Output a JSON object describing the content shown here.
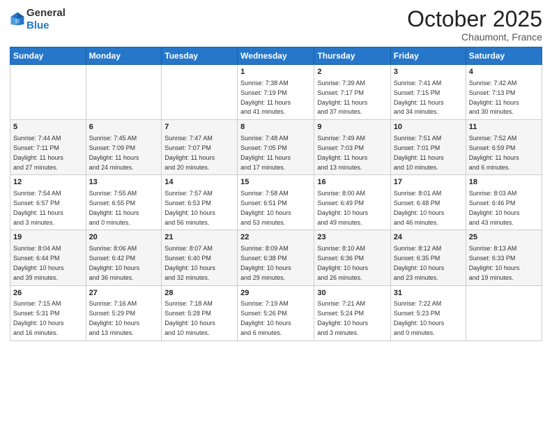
{
  "header": {
    "logo_general": "General",
    "logo_blue": "Blue",
    "month": "October 2025",
    "location": "Chaumont, France"
  },
  "days_of_week": [
    "Sunday",
    "Monday",
    "Tuesday",
    "Wednesday",
    "Thursday",
    "Friday",
    "Saturday"
  ],
  "weeks": [
    [
      {
        "day": "",
        "info": ""
      },
      {
        "day": "",
        "info": ""
      },
      {
        "day": "",
        "info": ""
      },
      {
        "day": "1",
        "info": "Sunrise: 7:38 AM\nSunset: 7:19 PM\nDaylight: 11 hours\nand 41 minutes."
      },
      {
        "day": "2",
        "info": "Sunrise: 7:39 AM\nSunset: 7:17 PM\nDaylight: 11 hours\nand 37 minutes."
      },
      {
        "day": "3",
        "info": "Sunrise: 7:41 AM\nSunset: 7:15 PM\nDaylight: 11 hours\nand 34 minutes."
      },
      {
        "day": "4",
        "info": "Sunrise: 7:42 AM\nSunset: 7:13 PM\nDaylight: 11 hours\nand 30 minutes."
      }
    ],
    [
      {
        "day": "5",
        "info": "Sunrise: 7:44 AM\nSunset: 7:11 PM\nDaylight: 11 hours\nand 27 minutes."
      },
      {
        "day": "6",
        "info": "Sunrise: 7:45 AM\nSunset: 7:09 PM\nDaylight: 11 hours\nand 24 minutes."
      },
      {
        "day": "7",
        "info": "Sunrise: 7:47 AM\nSunset: 7:07 PM\nDaylight: 11 hours\nand 20 minutes."
      },
      {
        "day": "8",
        "info": "Sunrise: 7:48 AM\nSunset: 7:05 PM\nDaylight: 11 hours\nand 17 minutes."
      },
      {
        "day": "9",
        "info": "Sunrise: 7:49 AM\nSunset: 7:03 PM\nDaylight: 11 hours\nand 13 minutes."
      },
      {
        "day": "10",
        "info": "Sunrise: 7:51 AM\nSunset: 7:01 PM\nDaylight: 11 hours\nand 10 minutes."
      },
      {
        "day": "11",
        "info": "Sunrise: 7:52 AM\nSunset: 6:59 PM\nDaylight: 11 hours\nand 6 minutes."
      }
    ],
    [
      {
        "day": "12",
        "info": "Sunrise: 7:54 AM\nSunset: 6:57 PM\nDaylight: 11 hours\nand 3 minutes."
      },
      {
        "day": "13",
        "info": "Sunrise: 7:55 AM\nSunset: 6:55 PM\nDaylight: 11 hours\nand 0 minutes."
      },
      {
        "day": "14",
        "info": "Sunrise: 7:57 AM\nSunset: 6:53 PM\nDaylight: 10 hours\nand 56 minutes."
      },
      {
        "day": "15",
        "info": "Sunrise: 7:58 AM\nSunset: 6:51 PM\nDaylight: 10 hours\nand 53 minutes."
      },
      {
        "day": "16",
        "info": "Sunrise: 8:00 AM\nSunset: 6:49 PM\nDaylight: 10 hours\nand 49 minutes."
      },
      {
        "day": "17",
        "info": "Sunrise: 8:01 AM\nSunset: 6:48 PM\nDaylight: 10 hours\nand 46 minutes."
      },
      {
        "day": "18",
        "info": "Sunrise: 8:03 AM\nSunset: 6:46 PM\nDaylight: 10 hours\nand 43 minutes."
      }
    ],
    [
      {
        "day": "19",
        "info": "Sunrise: 8:04 AM\nSunset: 6:44 PM\nDaylight: 10 hours\nand 39 minutes."
      },
      {
        "day": "20",
        "info": "Sunrise: 8:06 AM\nSunset: 6:42 PM\nDaylight: 10 hours\nand 36 minutes."
      },
      {
        "day": "21",
        "info": "Sunrise: 8:07 AM\nSunset: 6:40 PM\nDaylight: 10 hours\nand 32 minutes."
      },
      {
        "day": "22",
        "info": "Sunrise: 8:09 AM\nSunset: 6:38 PM\nDaylight: 10 hours\nand 29 minutes."
      },
      {
        "day": "23",
        "info": "Sunrise: 8:10 AM\nSunset: 6:36 PM\nDaylight: 10 hours\nand 26 minutes."
      },
      {
        "day": "24",
        "info": "Sunrise: 8:12 AM\nSunset: 6:35 PM\nDaylight: 10 hours\nand 23 minutes."
      },
      {
        "day": "25",
        "info": "Sunrise: 8:13 AM\nSunset: 6:33 PM\nDaylight: 10 hours\nand 19 minutes."
      }
    ],
    [
      {
        "day": "26",
        "info": "Sunrise: 7:15 AM\nSunset: 5:31 PM\nDaylight: 10 hours\nand 16 minutes."
      },
      {
        "day": "27",
        "info": "Sunrise: 7:16 AM\nSunset: 5:29 PM\nDaylight: 10 hours\nand 13 minutes."
      },
      {
        "day": "28",
        "info": "Sunrise: 7:18 AM\nSunset: 5:28 PM\nDaylight: 10 hours\nand 10 minutes."
      },
      {
        "day": "29",
        "info": "Sunrise: 7:19 AM\nSunset: 5:26 PM\nDaylight: 10 hours\nand 6 minutes."
      },
      {
        "day": "30",
        "info": "Sunrise: 7:21 AM\nSunset: 5:24 PM\nDaylight: 10 hours\nand 3 minutes."
      },
      {
        "day": "31",
        "info": "Sunrise: 7:22 AM\nSunset: 5:23 PM\nDaylight: 10 hours\nand 0 minutes."
      },
      {
        "day": "",
        "info": ""
      }
    ]
  ]
}
